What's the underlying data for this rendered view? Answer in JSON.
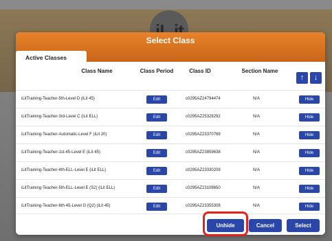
{
  "background": {
    "logo_text": "iL it"
  },
  "modal": {
    "title": "Select Class",
    "tab_label": "Active Classes",
    "columns": {
      "name": "Class Name",
      "period": "Class Period",
      "id": "Class ID",
      "section": "Section Name"
    },
    "arrow_up": "↑",
    "arrow_down": "↓",
    "edit_label": "Edit",
    "hide_label": "Hide",
    "rows": [
      {
        "name": "iLitTraining-Teacher-5th-Level D (iLit 45)",
        "id": "c0295AZ24794474",
        "section": "N/A"
      },
      {
        "name": "iLitTraining-Teacher-3rd-Level C (iLit ELL)",
        "id": "c0295AZ25328292",
        "section": "N/A"
      },
      {
        "name": "iLitTraining-Teacher-Automatic-Level F (iLit 20)",
        "id": "c0295AZ23370769",
        "section": "N/A"
      },
      {
        "name": "iLitTraining-Teacher-1st-45-Level E (iLit 45)",
        "id": "c0295AZ23859638",
        "section": "N/A"
      },
      {
        "name": "iLitTraining-Teacher-4th-ELL-Level E (iLit ELL)",
        "id": "c0295AZ23330209",
        "section": "N/A"
      },
      {
        "name": "iLitTraining-Teacher-5th-ELL-Level E (S2) (iLit ELL)",
        "id": "c0295AZ23108650",
        "section": "N/A"
      },
      {
        "name": "iLitTraining-Teacher-6th-45-Level G (Q2) (iLit 45)",
        "id": "c0295AZ23355308",
        "section": "N/A"
      }
    ],
    "footer": {
      "unhide": "Unhide",
      "cancel": "Cancel",
      "select": "Select"
    },
    "colors": {
      "accent": "#2946a8",
      "header": "#e07a27",
      "highlight": "#e0231c"
    }
  }
}
